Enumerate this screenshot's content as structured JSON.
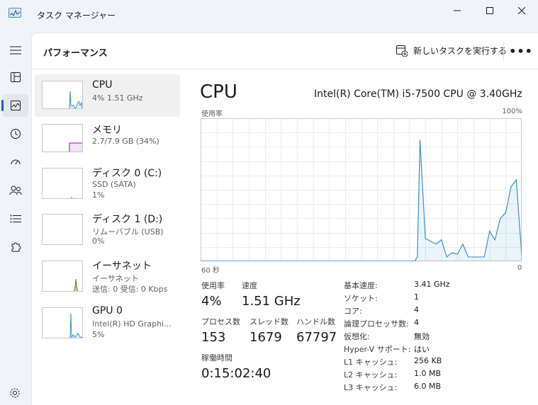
{
  "window": {
    "title": "タスク マネージャー"
  },
  "header": {
    "title": "パフォーマンス",
    "run_task_label": "新しいタスクを実行する",
    "more_label": "•••"
  },
  "sidebar": {
    "items": [
      {
        "name": "CPU",
        "sub": "4%  1.51 GHz"
      },
      {
        "name": "メモリ",
        "sub": "2.7/7.9 GB (34%)"
      },
      {
        "name": "ディスク 0 (C:)",
        "sub": "SSD (SATA)",
        "sub2": "1%"
      },
      {
        "name": "ディスク 1 (D:)",
        "sub": "リムーバブル (USB)",
        "sub2": "0%"
      },
      {
        "name": "イーサネット",
        "sub": "イーサネット",
        "sub2": "送信: 0 受信: 0 Kbps"
      },
      {
        "name": "GPU 0",
        "sub": "Intel(R) HD Graphi...",
        "sub2": "5%"
      }
    ]
  },
  "main": {
    "title": "CPU",
    "processor": "Intel(R) Core(TM) i5-7500 CPU @ 3.40GHz",
    "graph_label": "使用率",
    "graph_max": "100%",
    "time_left": "60 秒",
    "time_right": "0"
  },
  "chart_data": {
    "type": "area",
    "xlabel": "",
    "ylabel": "使用率",
    "xlim": [
      60,
      0
    ],
    "ylim": [
      0,
      100
    ],
    "grid": true,
    "x": [
      60,
      58,
      56,
      54,
      52,
      50,
      48,
      46,
      44,
      40,
      36,
      32,
      28,
      24,
      20,
      19.5,
      19,
      18,
      17,
      16,
      15,
      14,
      13,
      12,
      11,
      10,
      9,
      8,
      7,
      6,
      5,
      4,
      3,
      2,
      1,
      0.5,
      0
    ],
    "values": [
      0,
      0,
      0,
      0,
      0,
      0,
      0,
      0,
      0,
      0,
      0,
      0,
      0,
      0,
      0,
      3,
      85,
      16,
      14,
      12,
      15,
      3,
      6,
      5,
      12,
      3,
      3,
      3,
      3,
      21,
      15,
      30,
      34,
      52,
      57,
      30,
      5
    ],
    "color": "#3a8fc4"
  },
  "stats": {
    "usage_label": "使用率",
    "usage_value": "4%",
    "speed_label": "速度",
    "speed_value": "1.51 GHz",
    "processes_label": "プロセス数",
    "processes_value": "153",
    "threads_label": "スレッド数",
    "threads_value": "1679",
    "handles_label": "ハンドル数",
    "handles_value": "67797",
    "uptime_label": "稼働時間",
    "uptime_value": "0:15:02:40"
  },
  "info": [
    {
      "key": "基本速度:",
      "value": "3.41 GHz"
    },
    {
      "key": "ソケット:",
      "value": "1"
    },
    {
      "key": "コア:",
      "value": "4"
    },
    {
      "key": "論理プロセッサ数:",
      "value": "4"
    },
    {
      "key": "仮想化:",
      "value": "無効"
    },
    {
      "key": "Hyper-V サポート:",
      "value": "はい"
    },
    {
      "key": "L1 キャッシュ:",
      "value": "256 KB"
    },
    {
      "key": "L2 キャッシュ:",
      "value": "1.0 MB"
    },
    {
      "key": "L3 キャッシュ:",
      "value": "6.0 MB"
    }
  ],
  "colors": {
    "accent": "#0067c0",
    "cpu": "#3a8fc4",
    "memory": "#8b1a9b",
    "disk": "#4caf50",
    "ethernet": "#a0522d"
  }
}
